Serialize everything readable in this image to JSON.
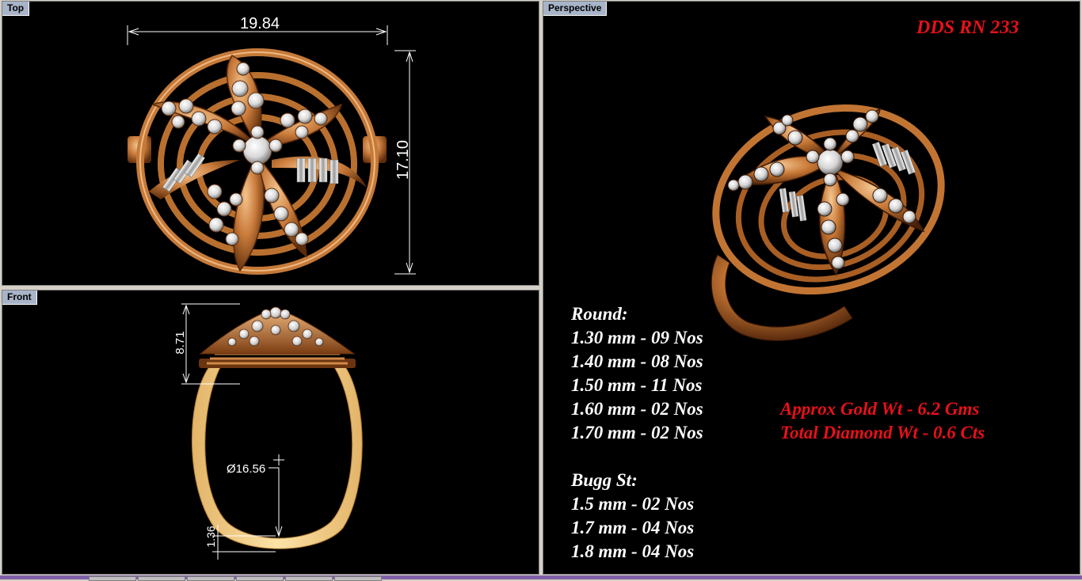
{
  "viewports": {
    "top": {
      "label": "Top",
      "dim_width": "19.84",
      "dim_height": "17.10"
    },
    "front": {
      "label": "Front",
      "dim_height": "8.71",
      "dim_diameter": "Ø16.56",
      "dim_band": "1.36"
    },
    "perspective": {
      "label": "Perspective"
    }
  },
  "design_code": "DDS RN 233",
  "stones": {
    "round_heading": "Round:",
    "round": [
      "1.30 mm - 09 Nos",
      "1.40 mm - 08 Nos",
      "1.50 mm - 11 Nos",
      "1.60 mm - 02 Nos",
      "1.70 mm - 02 Nos"
    ],
    "bugg_heading": "Bugg St:",
    "bugg": [
      "1.5 mm - 02 Nos",
      "1.7 mm - 04 Nos",
      "1.8 mm - 04 Nos"
    ]
  },
  "weights": {
    "gold": "Approx Gold Wt - 6.2 Gms",
    "diamond": "Total Diamond Wt - 0.6 Cts"
  },
  "colors": {
    "gold": "#c87a3a",
    "gold_light": "#f0c08a",
    "gold_dark": "#6a3410",
    "band_front": "#f5d08a",
    "diamond": "#e8e8e8",
    "accent_red": "#e8101a",
    "viewport_bg": "#000000",
    "label_bg": "#a8b4c8"
  }
}
